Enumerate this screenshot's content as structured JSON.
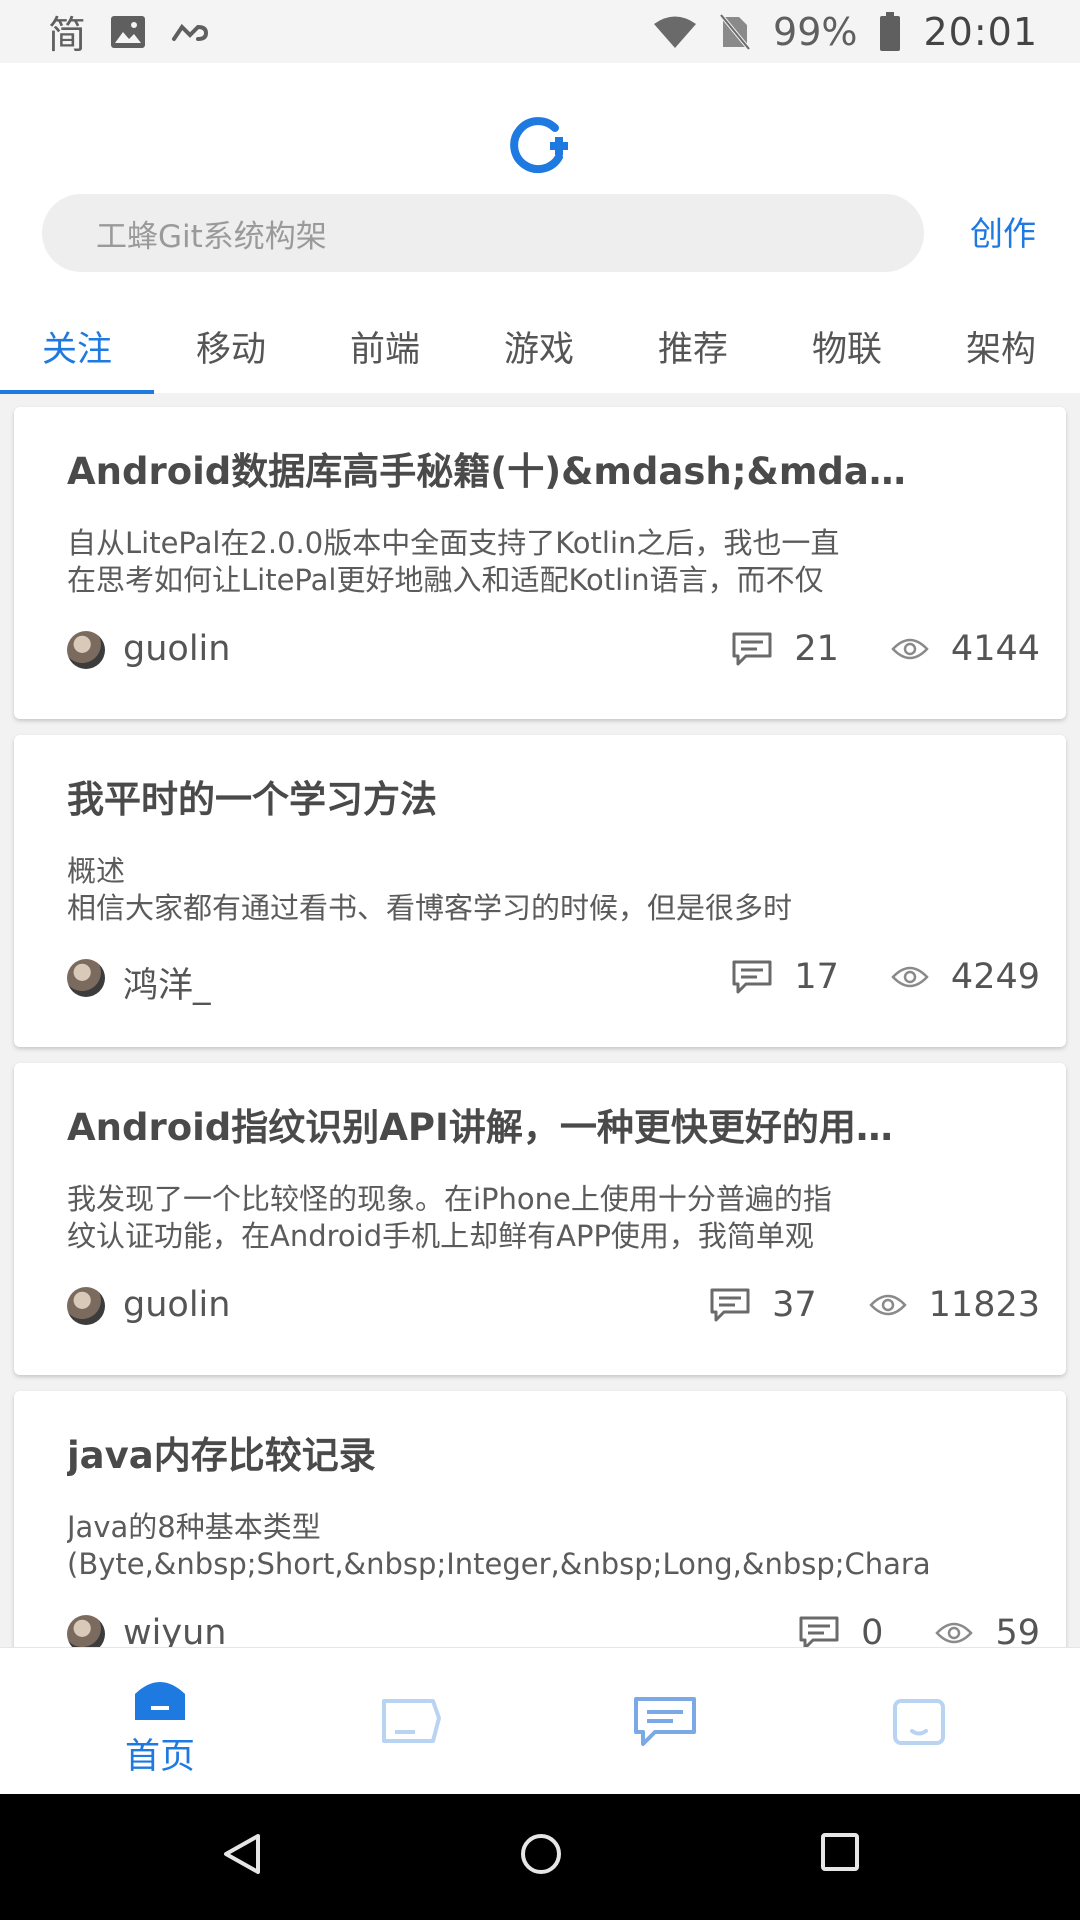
{
  "status_bar": {
    "ime_label": "简",
    "battery": "99%",
    "time": "20:01"
  },
  "header": {
    "search_placeholder": "工蜂Git系统构架",
    "create_label": "创作"
  },
  "tabs": [
    {
      "label": "关注",
      "active": true
    },
    {
      "label": "移动",
      "active": false
    },
    {
      "label": "前端",
      "active": false
    },
    {
      "label": "游戏",
      "active": false
    },
    {
      "label": "推荐",
      "active": false
    },
    {
      "label": "物联",
      "active": false
    },
    {
      "label": "架构",
      "active": false
    }
  ],
  "articles": [
    {
      "title": "Android数据库高手秘籍(十)&mdash;&mdash;",
      "desc_line1": "自从LitePal在2.0.0版本中全面支持了Kotlin之后，我也一直",
      "desc_line2": "在思考如何让LitePal更好地融入和适配Kotlin语言，而不仅",
      "author": "guolin",
      "comments": "21",
      "views": "4144"
    },
    {
      "title": "我平时的一个学习方法",
      "desc_line1": "概述",
      "desc_line2": "相信大家都有通过看书、看博客学习的时候，但是很多时",
      "author": "鸿洋_",
      "comments": "17",
      "views": "4249"
    },
    {
      "title": "Android指纹识别API讲解，一种更快更好的用户体验",
      "desc_line1": "我发现了一个比较怪的现象。在iPhone上使用十分普遍的指",
      "desc_line2": "纹认证功能，在Android手机上却鲜有APP使用，我简单观",
      "author": "guolin",
      "comments": "37",
      "views": "11823"
    },
    {
      "title": "java内存比较记录",
      "desc_line1": "Java的8种基本类型",
      "desc_line2": "(Byte,&nbsp;Short,&nbsp;Integer,&nbsp;Long,&nbsp;Chara",
      "author": "wiyun",
      "comments": "0",
      "views": "59"
    }
  ],
  "bottom_nav": {
    "home_label": "首页"
  },
  "colors": {
    "accent": "#1e7ae0",
    "inactive_nav": "#b9d3f3"
  },
  "icons": [
    "wifi-icon",
    "no-sim-icon",
    "battery-icon",
    "image-icon",
    "link-icon",
    "comment-icon",
    "eye-icon",
    "home-icon"
  ]
}
